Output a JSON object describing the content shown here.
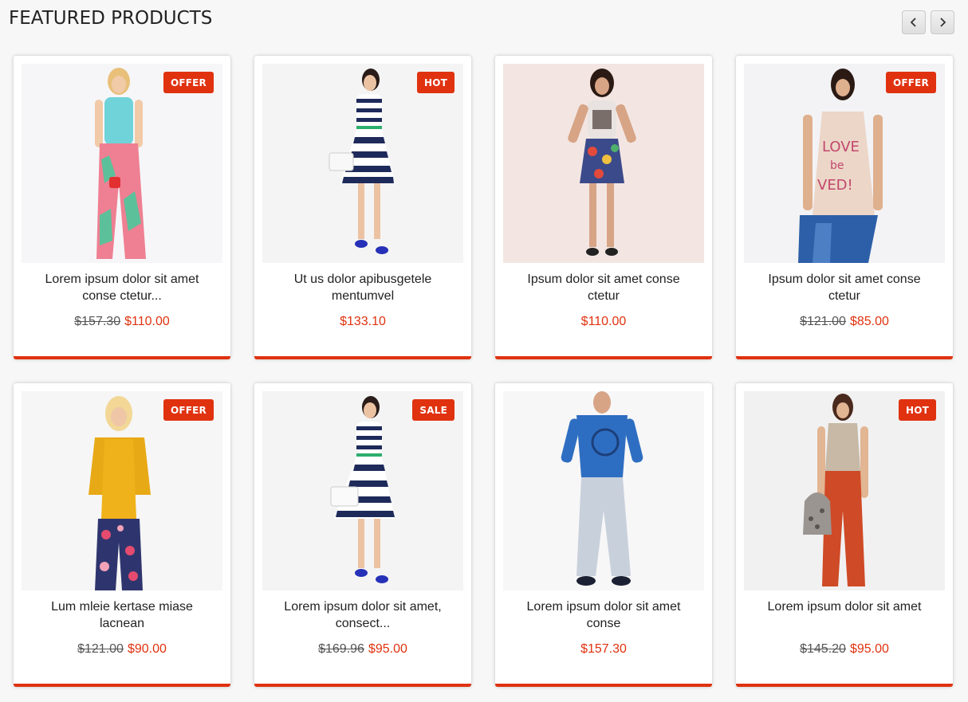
{
  "section": {
    "title": "FEATURED PRODUCTS"
  },
  "nav": {
    "prev_icon": "chevron-left-icon",
    "next_icon": "chevron-right-icon"
  },
  "colors": {
    "accent": "#e0320f",
    "background": "#f7f7f7",
    "card": "#ffffff"
  },
  "products": [
    {
      "name": "Lorem ipsum dolor sit amet conse ctetur...",
      "badge": "OFFER",
      "old_price": "$157.30",
      "price": "$110.00"
    },
    {
      "name": "Ut us dolor apibusgetele mentumvel",
      "badge": "HOT",
      "old_price": "",
      "price": "$133.10"
    },
    {
      "name": "Ipsum dolor sit amet conse ctetur",
      "badge": "",
      "old_price": "",
      "price": "$110.00"
    },
    {
      "name": "Ipsum dolor sit amet conse ctetur",
      "badge": "OFFER",
      "old_price": "$121.00",
      "price": "$85.00"
    },
    {
      "name": "Lum mleie kertase miase lacnean",
      "badge": "OFFER",
      "old_price": "$121.00",
      "price": "$90.00"
    },
    {
      "name": "Lorem ipsum dolor sit amet, consect...",
      "badge": "SALE",
      "old_price": "$169.96",
      "price": "$95.00"
    },
    {
      "name": "Lorem ipsum dolor sit amet conse",
      "badge": "",
      "old_price": "",
      "price": "$157.30"
    },
    {
      "name": "Lorem ipsum dolor sit amet",
      "badge": "HOT",
      "old_price": "$145.20",
      "price": "$95.00"
    }
  ]
}
